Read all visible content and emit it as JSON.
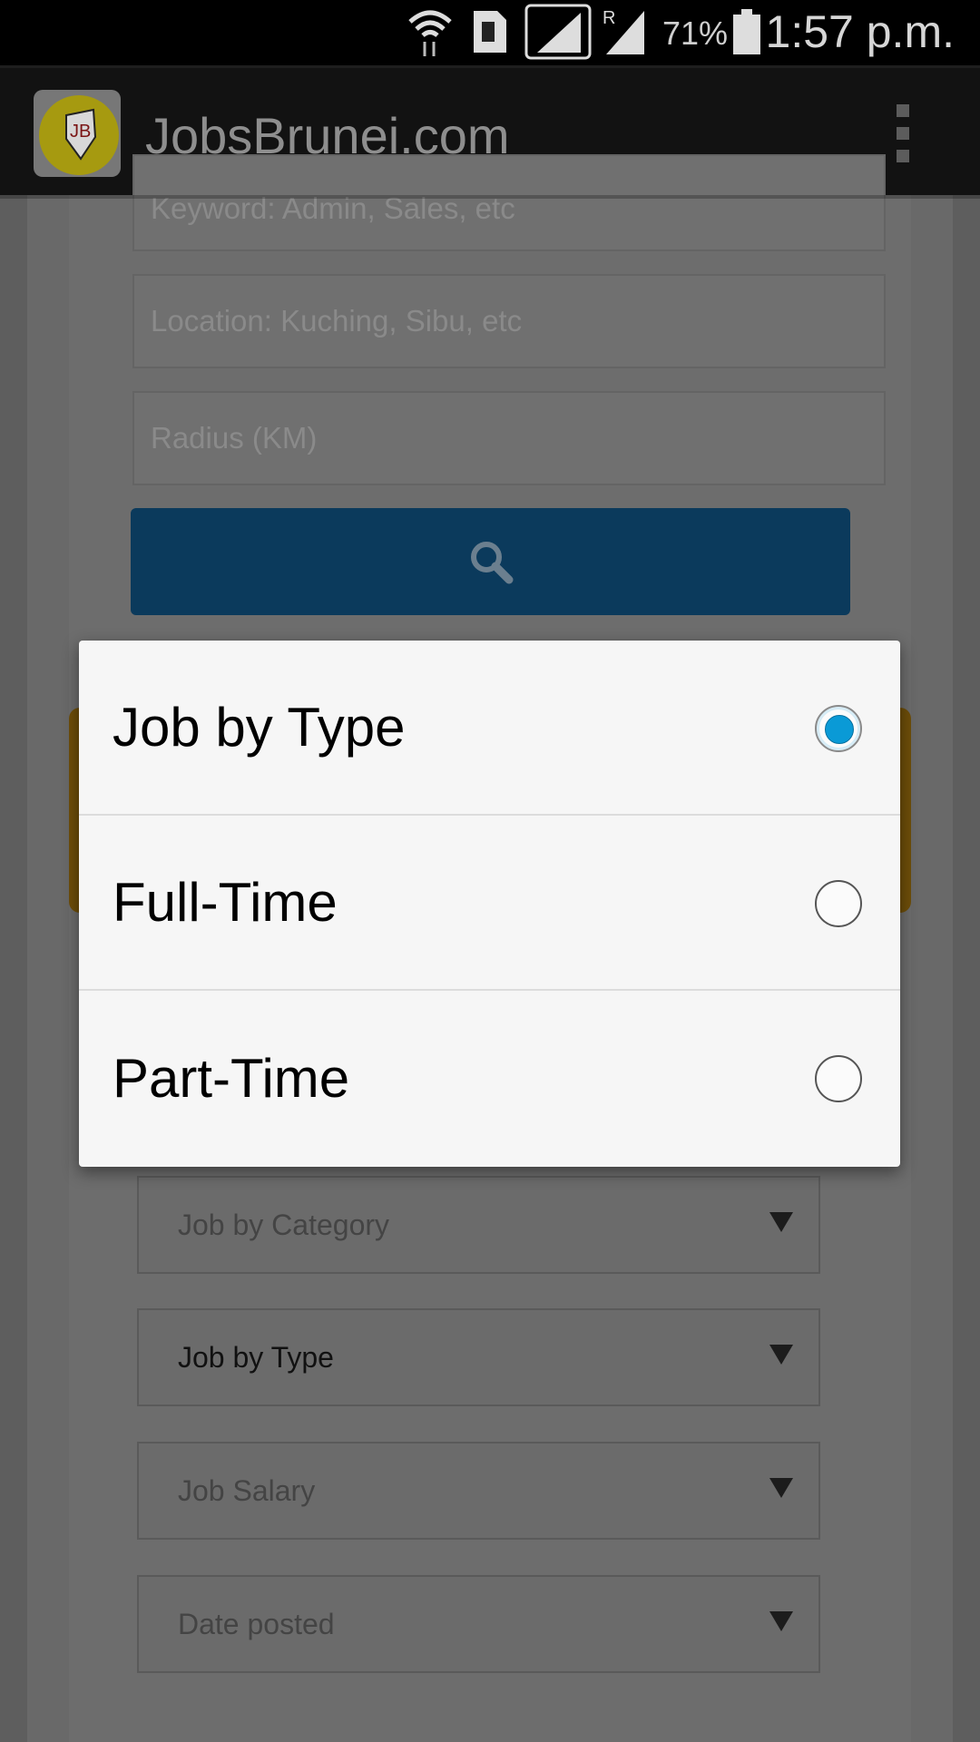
{
  "status_bar": {
    "battery_percent": "71%",
    "time": "1:57 p.m.",
    "icons": [
      "wifi-icon",
      "sim-icon",
      "signal-icon",
      "roaming-signal-icon",
      "battery-icon"
    ]
  },
  "app_bar": {
    "title": "JobsBrunei.com",
    "logo_text": "JB",
    "menu_icon": "overflow-menu-icon"
  },
  "search_form": {
    "keyword_placeholder": "Keyword: Admin, Sales, etc",
    "location_placeholder": "Location: Kuching, Sibu, etc",
    "radius_placeholder": "Radius (KM)",
    "search_icon": "search-icon",
    "button_color": "#0b3a5c"
  },
  "filters": [
    {
      "label": "Job by Category"
    },
    {
      "label": "Job by Type"
    },
    {
      "label": "Job Salary"
    },
    {
      "label": "Date posted"
    }
  ],
  "dialog": {
    "options": [
      {
        "label": "Job by Type",
        "selected": true
      },
      {
        "label": "Full-Time",
        "selected": false
      },
      {
        "label": "Part-Time",
        "selected": false
      }
    ],
    "accent": "#0a9ad6"
  }
}
